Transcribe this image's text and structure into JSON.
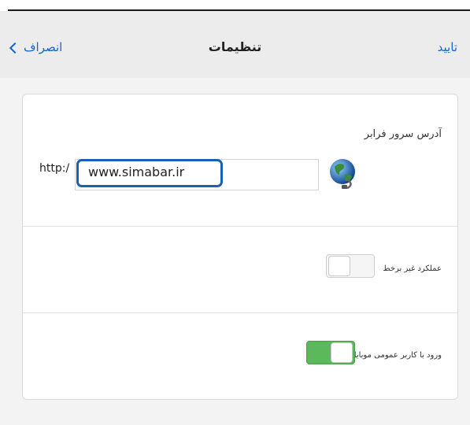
{
  "navbar": {
    "cancel_label": "انصراف",
    "title": "تنظیمات",
    "confirm_label": "تایید"
  },
  "server": {
    "label": "آدرس سرور فرابر",
    "prefix": "http:/",
    "url_value": "www.simabar.ir",
    "icon": "globe-icon"
  },
  "settings": {
    "offline_label": "عملکرد غیر برخط",
    "offline_enabled": false,
    "mobile_login_label": "ورود با کاربر عمومی موبایل",
    "mobile_login_enabled": true
  },
  "colors": {
    "accent": "#1663d4",
    "toggle_on": "#5cb85c",
    "highlight": "#1a5fb4"
  }
}
